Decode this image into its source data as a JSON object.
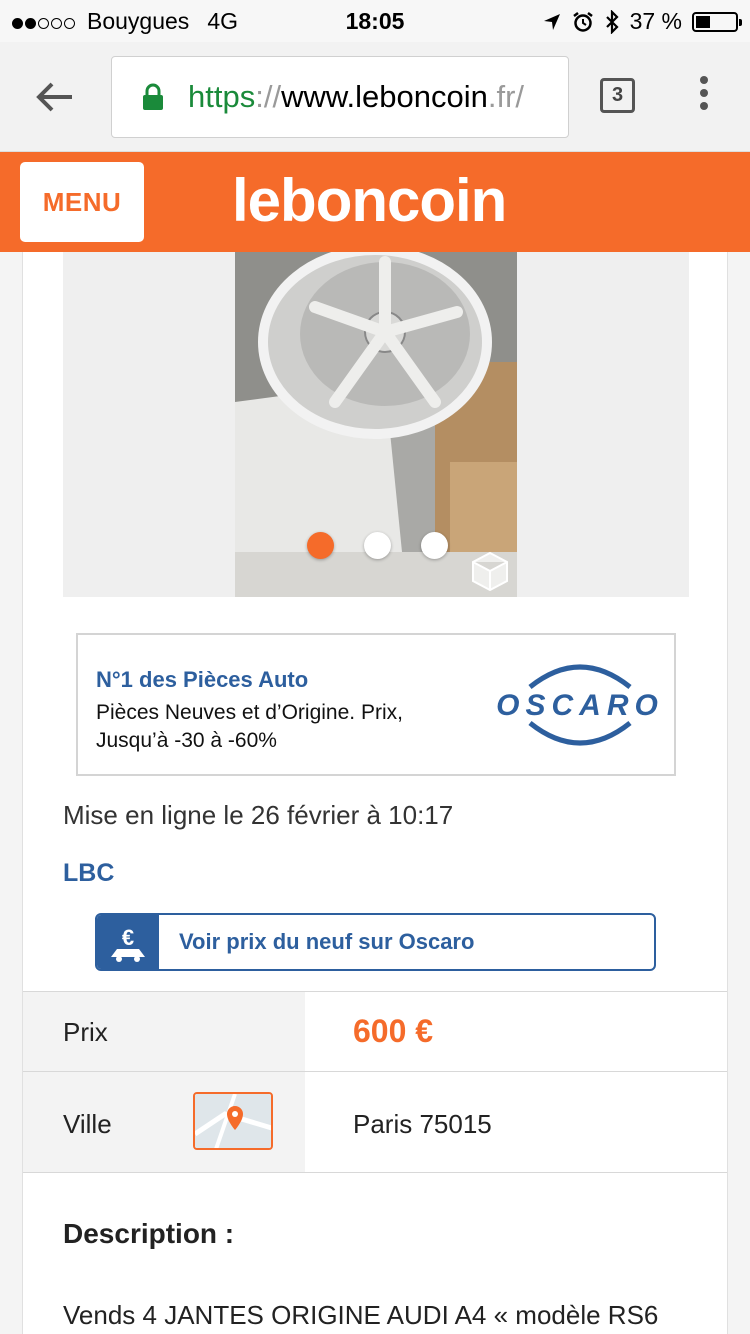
{
  "status_bar": {
    "carrier": "Bouygues",
    "network": "4G",
    "time": "18:05",
    "battery": "37 %"
  },
  "browser": {
    "url_scheme": "https",
    "url_sep": "://",
    "url_host": "www.leboncoin",
    "url_tail": ".fr/",
    "tab_count": "3"
  },
  "header": {
    "menu_label": "MENU",
    "logo_text": "leboncoin"
  },
  "gallery": {
    "image_count": 3,
    "active_index": 0
  },
  "ad_banner": {
    "title": "N°1 des Pièces Auto",
    "text": "Pièces Neuves et d’Origine. Prix, Jusqu’à -30 à -60%",
    "brand": "OSCARO"
  },
  "listing": {
    "posted": "Mise en ligne le 26 février à 10:17",
    "seller": "LBC",
    "oscaro_button": "Voir prix du neuf sur Oscaro",
    "price_label": "Prix",
    "price_value": "600 €",
    "city_label": "Ville",
    "city_value": "Paris 75015",
    "description_label": "Description :",
    "description_text": "Vends 4 JANTES ORIGINE AUDI A4 « modèle RS6"
  },
  "colors": {
    "brand_orange": "#f56b2a",
    "link_blue": "#2d5f9e",
    "secure_green": "#1a8a3a"
  }
}
